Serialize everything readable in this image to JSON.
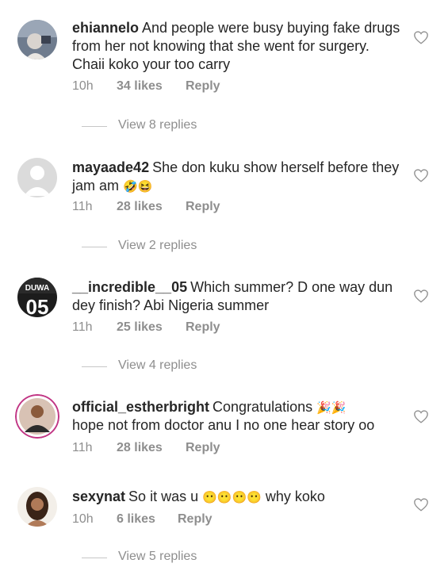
{
  "comments": [
    {
      "username": "ehiannelo",
      "text": "And people were busy buying fake drugs from her not knowing that she went for surgery. Chaii koko your too carry",
      "emojis": "",
      "time": "10h",
      "likes": "34 likes",
      "reply": "Reply",
      "view_replies": "View 8 replies",
      "avatar_icon": "user-photo-avatar-icon"
    },
    {
      "username": "mayaade42",
      "text": "She don kuku show herself before they jam am",
      "emojis": "🤣😆",
      "time": "11h",
      "likes": "28 likes",
      "reply": "Reply",
      "view_replies": "View 2 replies",
      "avatar_icon": "default-avatar-icon"
    },
    {
      "username": "__incredible__05",
      "text": "Which summer? D one way dun dey finish? Abi Nigeria summer",
      "emojis": "",
      "time": "11h",
      "likes": "25 likes",
      "reply": "Reply",
      "view_replies": "View 4 replies",
      "avatar_icon": "duwa-logo-avatar-icon",
      "avatar_text_top": "DUWA",
      "avatar_text_bottom": "05"
    },
    {
      "username": "official_estherbright",
      "text": "Congratulations",
      "text2": "hope not from doctor anu I no one hear story oo",
      "emojis": "🎉🎉",
      "time": "11h",
      "likes": "28 likes",
      "reply": "Reply",
      "view_replies": "",
      "avatar_icon": "story-ring-avatar-icon"
    },
    {
      "username": "sexynat",
      "text": "So it was u",
      "text2": "why koko",
      "emojis": "😶😶😶😶",
      "time": "10h",
      "likes": "6 likes",
      "reply": "Reply",
      "view_replies": "View 5 replies",
      "avatar_icon": "user-photo-avatar-icon"
    }
  ],
  "heart_icon": "heart-outline-icon",
  "colors": {
    "text": "#262626",
    "secondary": "#8e8e8e",
    "story_ring": "#c13584",
    "divider": "#c7c7c7"
  }
}
